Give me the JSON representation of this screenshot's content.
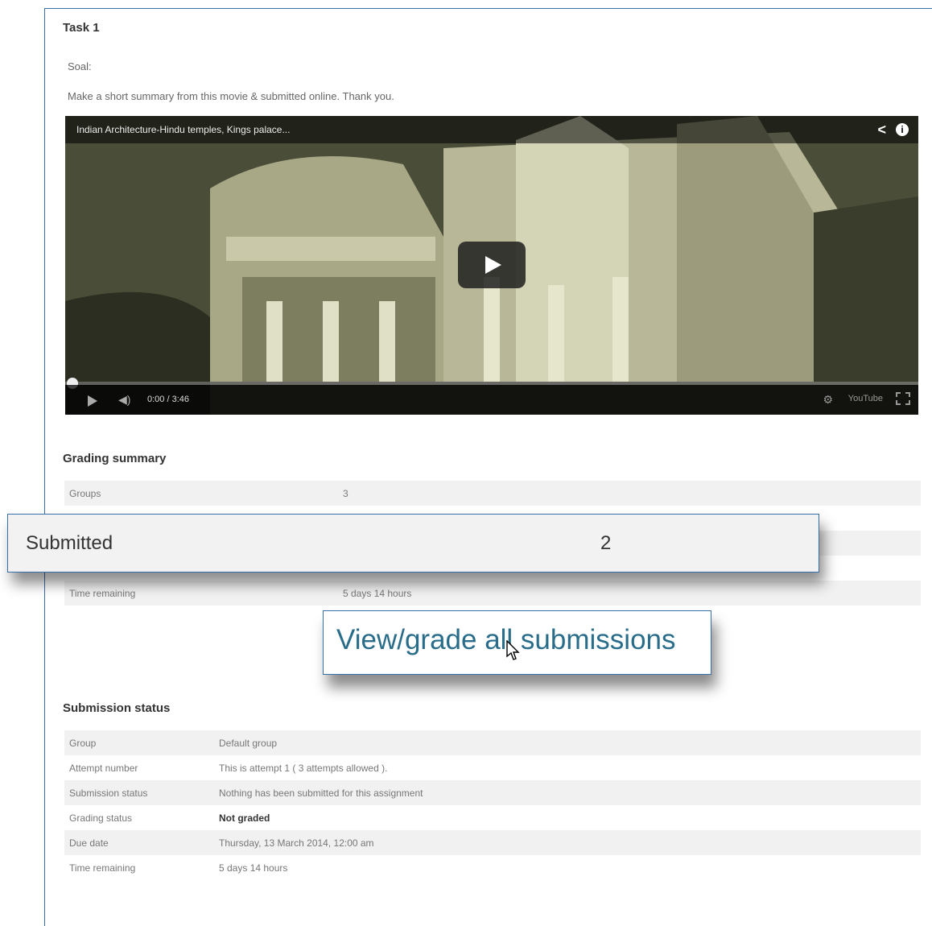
{
  "task": {
    "title": "Task 1",
    "intro_heading": "Soal:",
    "intro_text": "Make a short summary from this movie & submitted online. Thank you."
  },
  "video": {
    "title": "Indian Architecture-Hindu temples, Kings palace...",
    "timecode": "0:00 / 3:46",
    "progress": 0,
    "logo_text": "YouTube"
  },
  "grading_summary": {
    "heading": "Grading summary",
    "rows": [
      {
        "label": "Groups",
        "value": "3"
      },
      {
        "label": "Time remaining",
        "value": "5 days 14 hours"
      }
    ]
  },
  "callouts": {
    "submitted_label": "Submitted",
    "submitted_value": "2",
    "view_link": "View/grade all submissions"
  },
  "submission_status": {
    "heading": "Submission status",
    "rows": [
      {
        "label": "Group",
        "value": "Default group"
      },
      {
        "label": "Attempt number",
        "value": "This is attempt 1 ( 3 attempts allowed )."
      },
      {
        "label": "Submission status",
        "value": "Nothing has been submitted for this assignment"
      },
      {
        "label": "Grading status",
        "value": "Not graded"
      },
      {
        "label": "Due date",
        "value": "Thursday, 13 March 2014, 12:00 am"
      },
      {
        "label": "Time remaining",
        "value": "5 days 14 hours"
      }
    ]
  }
}
